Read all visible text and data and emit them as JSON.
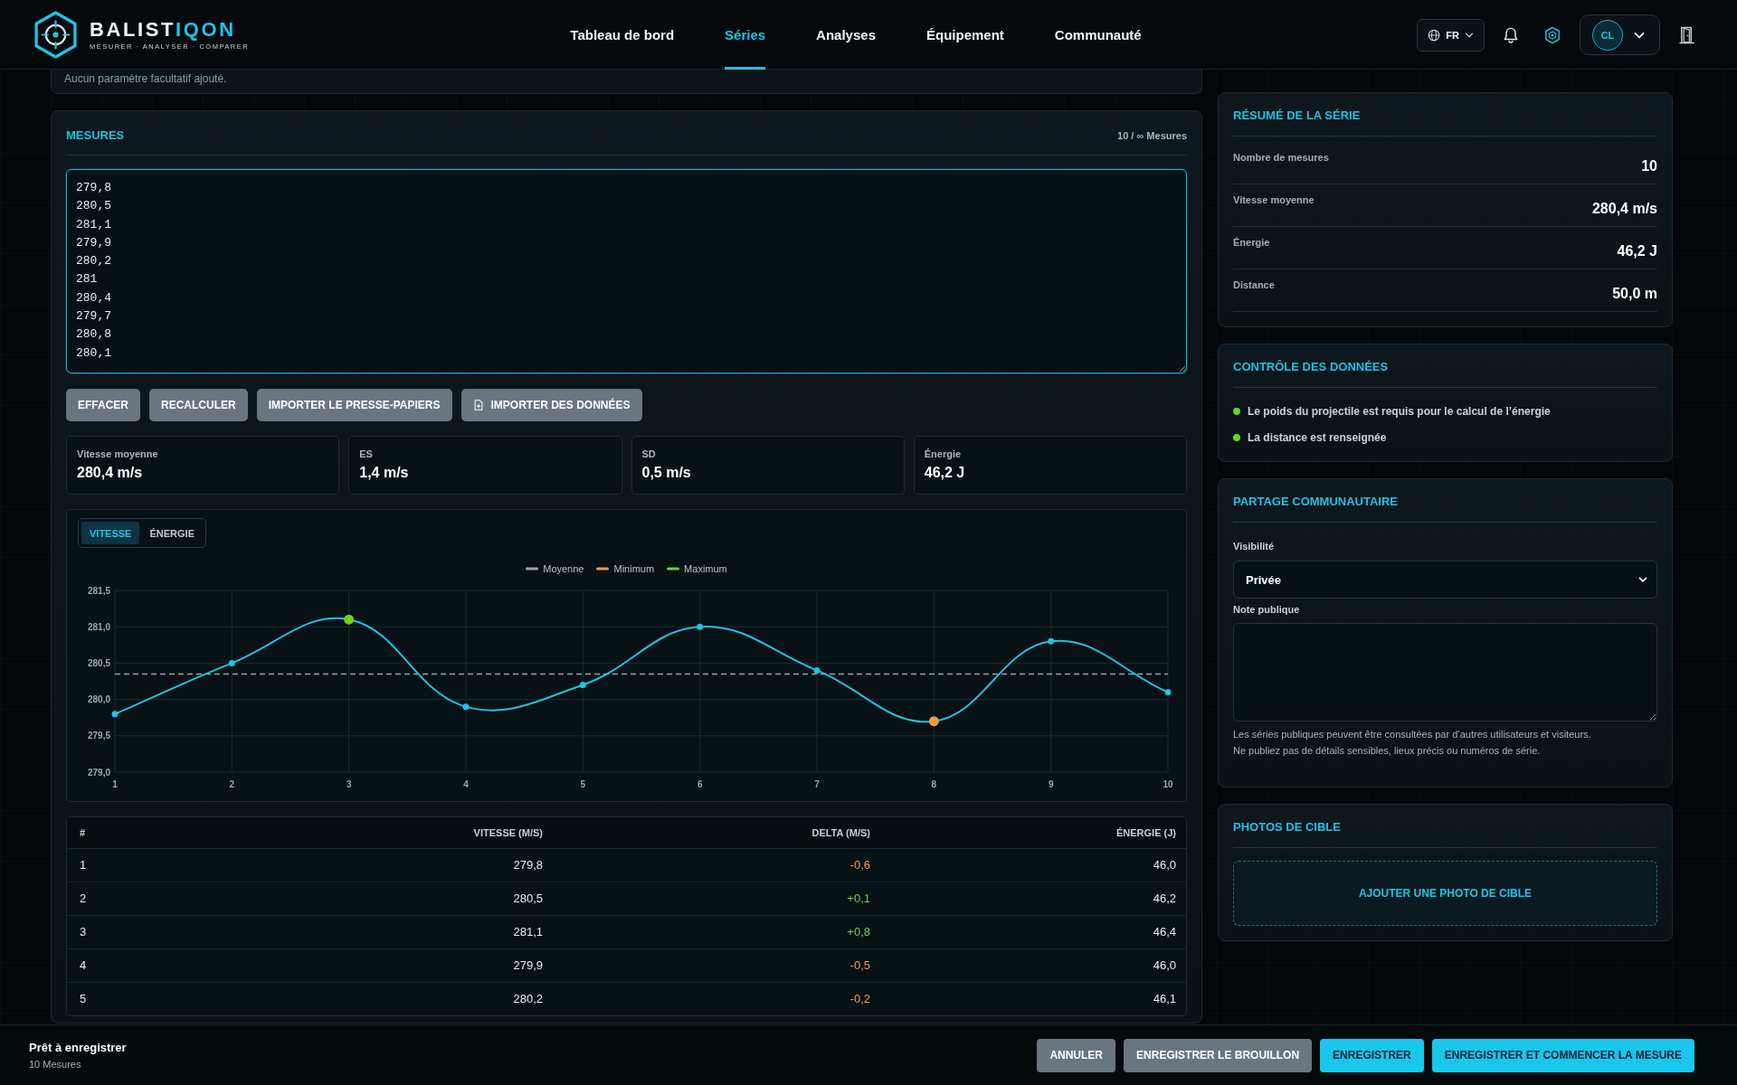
{
  "header": {
    "brand": {
      "name_parts": [
        {
          "text": "BALIST",
          "accent": false
        },
        {
          "text": "IQON",
          "accent": true
        }
      ],
      "tagline": "MESURER · ANALYSER · COMPARER"
    },
    "nav": [
      {
        "label": "Tableau de bord",
        "selected": false
      },
      {
        "label": "Séries",
        "selected": true
      },
      {
        "label": "Analyses",
        "selected": false
      },
      {
        "label": "Équipement",
        "selected": false
      },
      {
        "label": "Communauté",
        "selected": false
      }
    ],
    "language": "FR",
    "avatar_initials": "CL"
  },
  "optional_params_note": "Aucun paramètre facultatif ajouté.",
  "measures": {
    "title": "MESURES",
    "counter": "10 / ∞ Mesures",
    "input_value": "279,8\n280,5\n281,1\n279,9\n280,2\n281\n280,4\n279,7\n280,8\n280,1",
    "buttons": [
      {
        "label": "EFFACER",
        "kind": "plain"
      },
      {
        "label": "RECALCULER",
        "kind": "plain"
      },
      {
        "label": "IMPORTER LE PRESSE-PAPIERS",
        "kind": "plain"
      },
      {
        "label": "IMPORTER DES DONNÉES",
        "kind": "file"
      }
    ],
    "stats": [
      {
        "label": "Vitesse moyenne",
        "value": "280,4 m/s"
      },
      {
        "label": "ES",
        "value": "1,4 m/s"
      },
      {
        "label": "SD",
        "value": "0,5 m/s"
      },
      {
        "label": "Énergie",
        "value": "46,2 J"
      }
    ],
    "chart": {
      "tabs": [
        {
          "label": "VITESSE",
          "selected": true
        },
        {
          "label": "ÉNERGIE",
          "selected": false
        }
      ],
      "legend": [
        {
          "kind": "mean",
          "label": "Moyenne",
          "color": "#9aa3ab"
        },
        {
          "kind": "min",
          "label": "Minimum",
          "color": "#f29b45"
        },
        {
          "kind": "max",
          "label": "Maximum",
          "color": "#6cd31f"
        }
      ],
      "chart_data": {
        "type": "line",
        "categories": [
          "1",
          "2",
          "3",
          "4",
          "5",
          "6",
          "7",
          "8",
          "9",
          "10"
        ],
        "series": [
          {
            "color": "#1ec3e3",
            "marker": "circle",
            "values": [
              279.8,
              280.5,
              281.1,
              279.9,
              280.2,
              281.0,
              280.4,
              279.7,
              280.8,
              280.1
            ]
          }
        ],
        "ylim": [
          279,
          281.5
        ],
        "yticks": [
          {
            "value": 279,
            "label": "279,0"
          },
          {
            "value": 279.5,
            "label": "279,5"
          },
          {
            "value": 280,
            "label": "280,0"
          },
          {
            "value": 280.5,
            "label": "280,5"
          },
          {
            "value": 281,
            "label": "281,0"
          },
          {
            "value": 281.5,
            "label": "281,5"
          }
        ],
        "grid": true,
        "ref_lines": [
          {
            "axis": "y",
            "value": 280.35,
            "color": "#9aa3ab"
          }
        ]
      }
    },
    "table": {
      "columns": [
        "#",
        "VITESSE (M/S)",
        "DELTA (M/S)",
        "ÉNERGIE (J)"
      ],
      "rows": [
        {
          "number": "1",
          "speed": "279,8",
          "delta": {
            "text": "-0,6",
            "color": "#f29b5a"
          },
          "energy": "46,0"
        },
        {
          "number": "2",
          "speed": "280,5",
          "delta": {
            "text": "+0,1",
            "color": "#74d43c"
          },
          "energy": "46,2"
        },
        {
          "number": "3",
          "speed": "281,1",
          "delta": {
            "text": "+0,8",
            "color": "#74d43c"
          },
          "energy": "46,4"
        },
        {
          "number": "4",
          "speed": "279,9",
          "delta": {
            "text": "-0,5",
            "color": "#f29b5a"
          },
          "energy": "46,0"
        },
        {
          "number": "5",
          "speed": "280,2",
          "delta": {
            "text": "-0,2",
            "color": "#f29b5a"
          },
          "energy": "46,1"
        }
      ]
    }
  },
  "sidebar": {
    "summary": {
      "title": "RÉSUMÉ DE LA SÉRIE",
      "rows": [
        {
          "label": "Nombre de mesures",
          "value": "10"
        },
        {
          "label": "Vitesse moyenne",
          "value": "280,4 m/s"
        },
        {
          "label": "Énergie",
          "value": "46,2 J"
        },
        {
          "label": "Distance",
          "value": "50,0 m"
        }
      ]
    },
    "data_check": {
      "title": "CONTRÔLE DES DONNÉES",
      "items": [
        {
          "text": "Le poids du projectile est requis pour le calcul de l’énergie",
          "color": "#6cd31f"
        },
        {
          "text": "La distance est renseignée",
          "color": "#6cd31f"
        }
      ]
    },
    "sharing": {
      "title": "PARTAGE COMMUNAUTAIRE",
      "visibility_label": "Visibilité",
      "visibility_value": "Privée",
      "note_label": "Note publique",
      "help": [
        "Les séries publiques peuvent être consultées par d’autres utilisateurs et visiteurs.",
        "Ne publiez pas de détails sensibles, lieux précis ou numéros de série."
      ]
    },
    "photos": {
      "title": "PHOTOS DE CIBLE",
      "add_label": "AJOUTER UNE PHOTO DE CIBLE"
    }
  },
  "footer": {
    "status": "Prêt à enregistrer",
    "count": "10 Mesures",
    "buttons": [
      {
        "label": "ANNULER",
        "kind": "secondary"
      },
      {
        "label": "ENREGISTRER LE BROUILLON",
        "kind": "secondary"
      },
      {
        "label": "ENREGISTRER",
        "kind": "primary"
      },
      {
        "label": "ENREGISTRER ET COMMENCER LA MESURE",
        "kind": "primary"
      }
    ]
  }
}
